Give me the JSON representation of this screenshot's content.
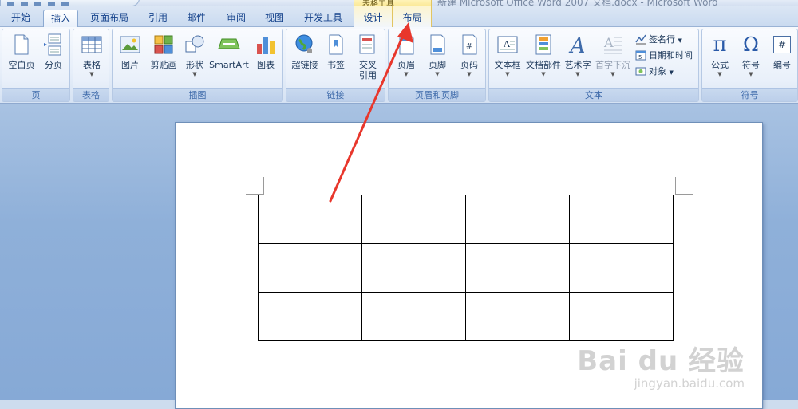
{
  "window": {
    "title": "新建 Microsoft Office Word 2007 文档.docx - Microsoft Word",
    "tools_group": "表格工具"
  },
  "tabs": [
    {
      "label": "开始",
      "active": false
    },
    {
      "label": "插入",
      "active": true
    },
    {
      "label": "页面布局",
      "active": false
    },
    {
      "label": "引用",
      "active": false
    },
    {
      "label": "邮件",
      "active": false
    },
    {
      "label": "审阅",
      "active": false
    },
    {
      "label": "视图",
      "active": false
    },
    {
      "label": "开发工具",
      "active": false
    },
    {
      "label": "设计",
      "active": false
    },
    {
      "label": "布局",
      "active": false
    }
  ],
  "ribbon": {
    "pages": {
      "label": "页",
      "blank_page": "空白页",
      "page_break": "分页"
    },
    "tables": {
      "label": "表格",
      "table": "表格"
    },
    "illustrations": {
      "label": "插图",
      "picture": "图片",
      "clipart": "剪贴画",
      "shapes": "形状",
      "smartart": "SmartArt",
      "chart": "图表"
    },
    "links": {
      "label": "链接",
      "hyperlink": "超链接",
      "bookmark": "书签",
      "cross_ref_1": "交叉",
      "cross_ref_2": "引用"
    },
    "header_footer": {
      "label": "页眉和页脚",
      "header": "页眉",
      "footer": "页脚",
      "page_number": "页码"
    },
    "text": {
      "label": "文本",
      "textbox": "文本框",
      "quick_parts": "文档部件",
      "wordart": "艺术字",
      "dropcap": "首字下沉",
      "signature": "签名行",
      "datetime": "日期和时间",
      "object": "对象"
    },
    "symbols": {
      "label": "符号",
      "equation": "公式",
      "symbol": "符号",
      "numbering": "编号"
    }
  },
  "document": {
    "table": {
      "rows": 3,
      "cols": 4
    },
    "watermark_logo": "Bai du 经验",
    "watermark_url": "jingyan.baidu.com"
  },
  "colors": {
    "ribbon_text": "#1e395b",
    "group_label": "#3e6aaa",
    "arrow": "#e8372c"
  },
  "icons": {
    "symbols_equation": "π",
    "symbols_symbol": "Ω",
    "symbols_numbering": "#"
  }
}
